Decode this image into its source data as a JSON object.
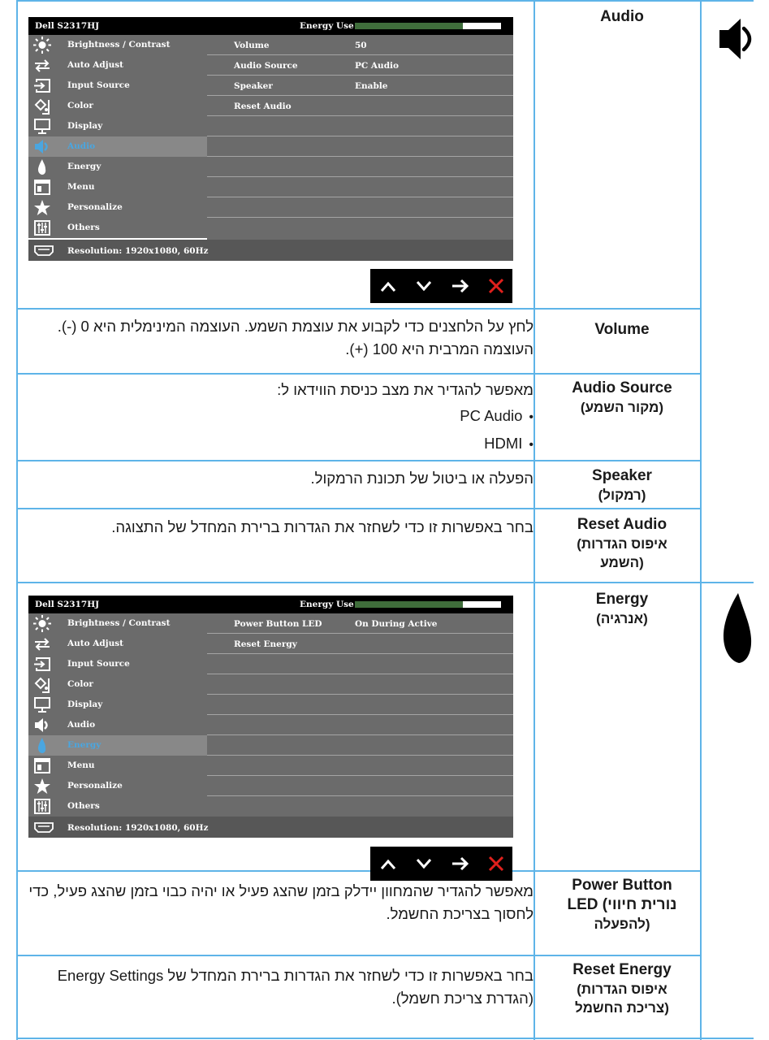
{
  "osd": {
    "model": "Dell S2317HJ",
    "energy_use_label": "Energy Use",
    "energy_use_level": 0.74,
    "menu_items": [
      "Brightness / Contrast",
      "Auto Adjust",
      "Input Source",
      "Color",
      "Display",
      "Audio",
      "Energy",
      "Menu",
      "Personalize",
      "Others"
    ],
    "resolution": "Resolution: 1920x1080, 60Hz",
    "audio_submenu": [
      {
        "label": "Volume",
        "value": "50"
      },
      {
        "label": "Audio Source",
        "value": "PC Audio"
      },
      {
        "label": "Speaker",
        "value": "Enable"
      },
      {
        "label": "Reset Audio",
        "value": ""
      }
    ],
    "energy_submenu": [
      {
        "label": "Power Button LED",
        "value": "On During Active"
      },
      {
        "label": "Reset Energy",
        "value": ""
      }
    ]
  },
  "rows": {
    "audio": {
      "label": "Audio"
    },
    "volume": {
      "label": "Volume",
      "desc": "לחץ על הלחצנים כדי לקבוע את עוצמת השמע. העוצמה המינימלית היא 0 (-). העוצמה המרבית היא 100 (+)."
    },
    "audio_source": {
      "label": "Audio Source",
      "label_he": "(מקור השמע)",
      "desc": "מאפשר להגדיר את מצב כניסת הווידאו ל:",
      "options": [
        "PC Audio",
        "HDMI"
      ]
    },
    "speaker": {
      "label": "Speaker",
      "label_he": "(רמקול)",
      "desc": "הפעלה או ביטול של תכונת הרמקול."
    },
    "reset_audio": {
      "label": "Reset Audio",
      "label_he_1": "(איפוס הגדרות",
      "label_he_2": "השמע)",
      "desc": "בחר באפשרות זו כדי לשחזר את הגדרות ברירת המחדל של התצוגה."
    },
    "energy": {
      "label": "Energy",
      "label_he": "(אנרגיה)"
    },
    "power_led": {
      "label_1": "Power Button",
      "label_2": "LED (נורית חיווי",
      "label_3": "להפעלה)",
      "desc": "מאפשר להגדיר שהמחוון יידלק בזמן שהצג פעיל או יהיה כבוי בזמן שהצג פעיל, כדי לחסוך בצריכת החשמל."
    },
    "reset_energy": {
      "label": "Reset Energy",
      "label_he_1": "(איפוס הגדרות",
      "label_he_2": "צריכת החשמל)",
      "desc": "בחר באפשרות זו כדי לשחזר את הגדרות ברירת המחדל של Energy Settings (הגדרת צריכת חשמל)."
    }
  },
  "icons": {
    "side_audio": "speaker-icon",
    "side_energy": "leaf-flame-icon",
    "nav": [
      "up-arrow-icon",
      "down-arrow-icon",
      "right-arrow-icon",
      "close-icon"
    ]
  },
  "colors": {
    "rule": "#5eb4e8",
    "energy_bar": "#3f6d3b",
    "close": "#e0201c"
  }
}
